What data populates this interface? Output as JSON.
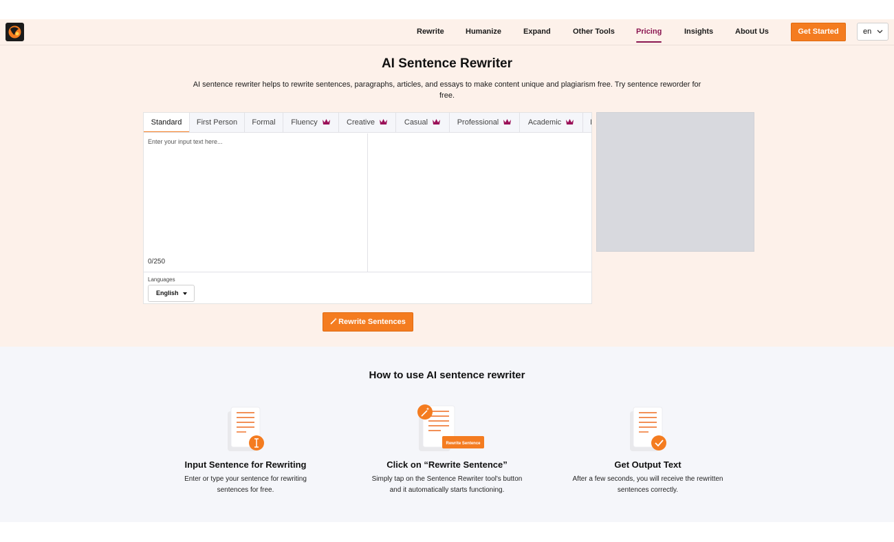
{
  "header": {
    "logo_icon": "app-logo-icon",
    "nav": [
      "Rewrite",
      "Humanize",
      "Expand",
      "Other Tools",
      "Pricing",
      "Insights",
      "About Us"
    ],
    "active_nav": "Pricing",
    "cta_label": "Get Started",
    "language_value": "en"
  },
  "hero": {
    "title": "AI Sentence Rewriter",
    "subtitle": "AI sentence rewriter helps to rewrite sentences, paragraphs, articles, and essays to make content unique and plagiarism free. Try sentence reworder for free."
  },
  "tool": {
    "tabs": [
      {
        "label": "Standard",
        "premium": false
      },
      {
        "label": "First Person",
        "premium": false
      },
      {
        "label": "Formal",
        "premium": false
      },
      {
        "label": "Fluency",
        "premium": true
      },
      {
        "label": "Creative",
        "premium": true
      },
      {
        "label": "Casual",
        "premium": true
      },
      {
        "label": "Professional",
        "premium": true
      },
      {
        "label": "Academic",
        "premium": true
      },
      {
        "label": "I",
        "premium": false
      }
    ],
    "active_tab": "Standard",
    "input_placeholder": "Enter your input text here...",
    "input_value": "",
    "counter": "0/250",
    "languages_label": "Languages",
    "language_value": "English",
    "premium_icon": "crown-icon",
    "accent_color": "#f47c20",
    "crown_color": "#9b1058"
  },
  "rewrite_button_label": "Rewrite Sentences",
  "howto": {
    "title": "How to use AI sentence rewriter",
    "steps": [
      {
        "title": "Input Sentence for Rewriting",
        "desc": "Enter or type your sentence for rewriting sentences for free.",
        "icon": "document-cursor-icon"
      },
      {
        "title": "Click on “Rewrite Sentence”",
        "desc": "Simply tap on the Sentence Rewriter tool's button and it automatically starts functioning.",
        "icon": "document-button-icon",
        "button_label": "Rewrite Sentence"
      },
      {
        "title": "Get Output Text",
        "desc": "After a few seconds, you will receive the rewritten sentences correctly.",
        "icon": "document-check-icon"
      }
    ]
  }
}
